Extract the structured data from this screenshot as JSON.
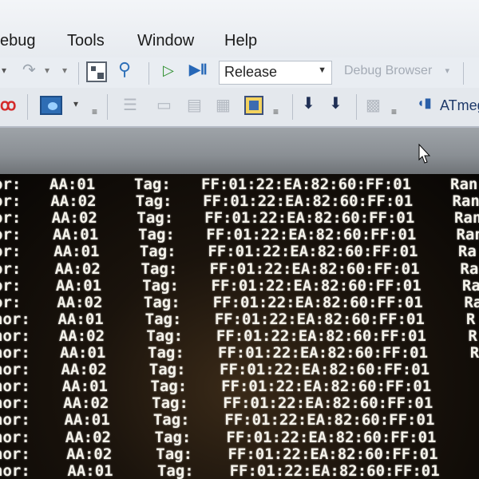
{
  "menubar": {
    "items": [
      "ebug",
      "Tools",
      "Window",
      "Help"
    ]
  },
  "toolbar1": {
    "config_value": "Release",
    "debug_browser_label": "Debug Browser"
  },
  "toolbar2": {
    "device_label": "ATmeg"
  },
  "console": {
    "rows": [
      {
        "c1": "or:",
        "c2": "AA:01",
        "c3": "Tag:",
        "c4": "FF:01:22:EA:82:60:FF:01",
        "c5": "Ran"
      },
      {
        "c1": "or:",
        "c2": "AA:02",
        "c3": "Tag:",
        "c4": "FF:01:22:EA:82:60:FF:01",
        "c5": "Ran"
      },
      {
        "c1": "or:",
        "c2": "AA:02",
        "c3": "Tag:",
        "c4": "FF:01:22:EA:82:60:FF:01",
        "c5": "Ran"
      },
      {
        "c1": "or:",
        "c2": "AA:01",
        "c3": "Tag:",
        "c4": "FF:01:22:EA:82:60:FF:01",
        "c5": "Ran"
      },
      {
        "c1": "or:",
        "c2": "AA:01",
        "c3": "Tag:",
        "c4": "FF:01:22:EA:82:60:FF:01",
        "c5": "Ra"
      },
      {
        "c1": "or:",
        "c2": "AA:02",
        "c3": "Tag:",
        "c4": "FF:01:22:EA:82:60:FF:01",
        "c5": "Ra"
      },
      {
        "c1": "or:",
        "c2": "AA:01",
        "c3": "Tag:",
        "c4": "FF:01:22:EA:82:60:FF:01",
        "c5": "Ra"
      },
      {
        "c1": "or:",
        "c2": "AA:02",
        "c3": "Tag:",
        "c4": "FF:01:22:EA:82:60:FF:01",
        "c5": "Ra"
      },
      {
        "c1": "nor:",
        "c2": "AA:01",
        "c3": "Tag:",
        "c4": "FF:01:22:EA:82:60:FF:01",
        "c5": "R"
      },
      {
        "c1": "nor:",
        "c2": "AA:02",
        "c3": "Tag:",
        "c4": "FF:01:22:EA:82:60:FF:01",
        "c5": "R"
      },
      {
        "c1": "hor:",
        "c2": "AA:01",
        "c3": "Tag:",
        "c4": "FF:01:22:EA:82:60:FF:01",
        "c5": "R"
      },
      {
        "c1": "hor:",
        "c2": "AA:02",
        "c3": "Tag:",
        "c4": "FF:01:22:EA:82:60:FF:01",
        "c5": ""
      },
      {
        "c1": "nor:",
        "c2": "AA:01",
        "c3": "Tag:",
        "c4": "FF:01:22:EA:82:60:FF:01",
        "c5": ""
      },
      {
        "c1": "hor:",
        "c2": "AA:02",
        "c3": "Tag:",
        "c4": "FF:01:22:EA:82:60:FF:01",
        "c5": ""
      },
      {
        "c1": "hor:",
        "c2": "AA:01",
        "c3": "Tag:",
        "c4": "FF:01:22:EA:82:60:FF:01",
        "c5": ""
      },
      {
        "c1": "nor:",
        "c2": "AA:02",
        "c3": "Tag:",
        "c4": "FF:01:22:EA:82:60:FF:01",
        "c5": ""
      },
      {
        "c1": "hor:",
        "c2": "AA:02",
        "c3": "Tag:",
        "c4": "FF:01:22:EA:82:60:FF:01",
        "c5": ""
      },
      {
        "c1": "hor:",
        "c2": "AA:01",
        "c3": "Tag:",
        "c4": "FF:01:22:EA:82:60:FF:01",
        "c5": ""
      }
    ]
  }
}
